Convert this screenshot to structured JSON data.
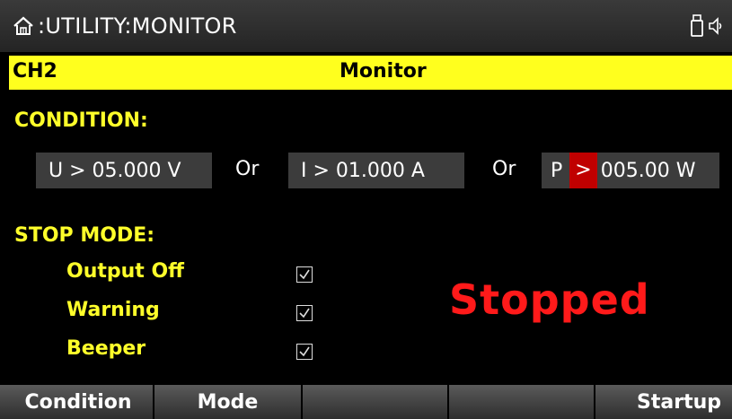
{
  "header": {
    "path": ":UTILITY:MONITOR",
    "icons": [
      "home-icon",
      "usb-icon",
      "speaker-icon"
    ]
  },
  "channel_bar": {
    "channel": "CH2",
    "title": "Monitor"
  },
  "condition": {
    "label": "CONDITION:",
    "voltage": {
      "prefix": "U > ",
      "value": "05.000",
      "unit": " V"
    },
    "or1": "Or",
    "current": {
      "prefix": "I > ",
      "value": "01.000",
      "unit": " A"
    },
    "or2": "Or",
    "power": {
      "prefix": "P",
      "operator": ">",
      "value": "005.00",
      "unit": " W"
    }
  },
  "stop_mode": {
    "label": "STOP MODE:",
    "options": [
      {
        "label": "Output Off",
        "checked": true
      },
      {
        "label": "Warning",
        "checked": true
      },
      {
        "label": "Beeper",
        "checked": true
      }
    ]
  },
  "status": "Stopped",
  "softkeys": [
    "Condition",
    "Mode",
    "",
    "",
    "Startup"
  ],
  "colors": {
    "accent_yellow": "#ffff1e",
    "label_yellow": "#ffff2a",
    "status_red": "#ff1a1a",
    "selection_red": "#c00000",
    "field_gray": "#3c3c3c"
  }
}
